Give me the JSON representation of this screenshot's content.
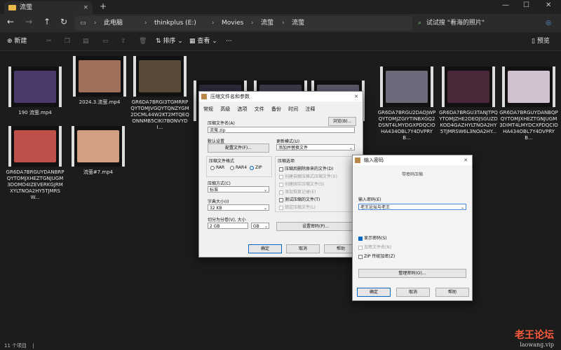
{
  "tab": {
    "label": "流萤",
    "close": "×"
  },
  "newtab": "+",
  "window": {
    "min": "—",
    "max": "☐",
    "close": "✕"
  },
  "breadcrumb": [
    "此电脑",
    "thinkplus (E:)",
    "Movies",
    "流萤",
    "流萤"
  ],
  "search": {
    "placeholder": "试试搜 \"看海的照片\""
  },
  "toolbar": {
    "new": "新建",
    "sort": "排序",
    "view": "查看",
    "more": "···",
    "preview": "预览"
  },
  "files": [
    {
      "name": "190 流萤.mp4",
      "color": "#4a3a6a"
    },
    {
      "name": "2024.3.流萤.mp4",
      "color": "#a0705a"
    },
    {
      "name": "GR6DA7BRGI3TGMRRPQYTOMJVGQYTQNZYGM2DCML44W2KT2MTQEQONNMB5CIKI7BONVYDI...",
      "color": "#5a4a3a"
    },
    {
      "name": "",
      "color": "#2a2a3a"
    },
    {
      "name": "",
      "color": "#3a3a4a"
    },
    {
      "name": "",
      "color": "#5a5a6a"
    },
    {
      "name": "GR6DA7BRGU2DAOJWPQYTOMJZGIYTINBXGQ2DSNT4LMYDGXPDQCIOHA434OBL7Y4DVPRYB...",
      "color": "#6a6a7a"
    },
    {
      "name": "GR6DA7BRGU3TANJTPQYTOMJZHE2DEOJSGUZDKOD4GAZHYLTNOA2HY5TJMRSW6L3NOA2HY...",
      "color": "#4a2a3a"
    },
    {
      "name": "GR6DA7BRGUYDANBQPQYTOMJXHEZTGNJUGM3DIMT4LMYDCXPDQCIOHA434OBL7Y4DVPRYB...",
      "color": "#d0c0d0"
    },
    {
      "name": "GR6DA7BRGUYDANBRPQYTOMJXHEZTGNJUGM3DOMD4IZEVERKGJRMXYLTNOA2HY5TJMRSW...",
      "color": "#c0504a"
    },
    {
      "name": "流萤#7.mp4",
      "color": "#d0a080"
    }
  ],
  "status": "11 个项目",
  "archive_dialog": {
    "title": "压缩文件名和参数",
    "menu": [
      "常规",
      "高级",
      "选项",
      "文件",
      "备份",
      "时间",
      "注释"
    ],
    "archive_name_label": "压缩文件名(A)",
    "archive_name_value": "流萤.zip",
    "browse": "浏览(B)...",
    "default_settings_label": "默认设置",
    "profiles_button": "配置文件(F)...",
    "update_mode_label": "更新模式(U)",
    "update_mode_value": "添加并替换文件",
    "format_label": "压缩文件格式",
    "format_options": [
      "RAR",
      "RAR4",
      "ZIP"
    ],
    "format_selected": "ZIP",
    "options_label": "压缩选项",
    "options": [
      {
        "label": "压缩后删除原来的文件(D)",
        "enabled": true,
        "checked": false
      },
      {
        "label": "创建自解压格式压缩文件(X)",
        "enabled": false,
        "checked": false
      },
      {
        "label": "创建固实压缩文件(S)",
        "enabled": false,
        "checked": false
      },
      {
        "label": "添加恢复记录(E)",
        "enabled": false,
        "checked": false
      },
      {
        "label": "测试压缩的文件(T)",
        "enabled": true,
        "checked": false
      },
      {
        "label": "锁定压缩文件(L)",
        "enabled": false,
        "checked": false
      }
    ],
    "method_label": "压缩方式(C)",
    "method_value": "标准",
    "dict_label": "字典大小(I)",
    "dict_value": "32 KB",
    "split_label": "切分为分卷(V), 大小",
    "split_value": "2 GB",
    "split_unit": "GB",
    "password_button": "设置密码(P)...",
    "ok": "确定",
    "cancel": "取消",
    "help": "帮助"
  },
  "password_dialog": {
    "title": "输入密码",
    "subtitle": "带密码压缩",
    "enter_label": "输入密码(E)",
    "password_value": "老王论坛与老王",
    "show_password": "显示密码(S)",
    "encrypt_names": "加密文件名(N)",
    "zip_legacy": "ZIP 传统加密(Z)",
    "organize": "整理密码(O)...",
    "ok": "确定",
    "cancel": "取消",
    "help": "帮助"
  },
  "watermark": {
    "line1": "老王论坛",
    "line2": "laowang.vip"
  }
}
